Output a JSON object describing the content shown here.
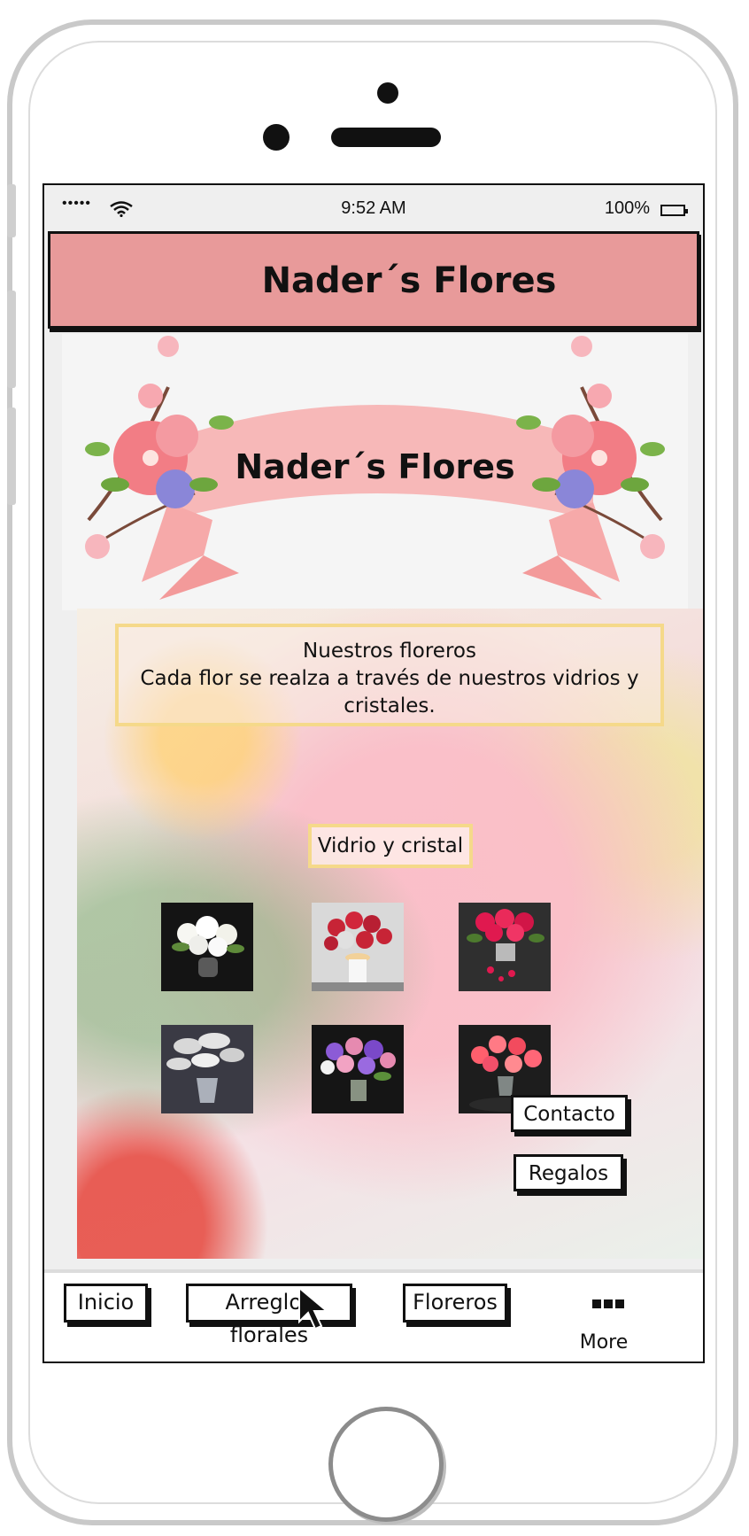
{
  "status_bar": {
    "signal": "•••••",
    "time": "9:52 AM",
    "battery": "100%"
  },
  "header": {
    "title": "Nader´s Flores"
  },
  "banner": {
    "title": "Nader´s Flores"
  },
  "intro": {
    "heading": "Nuestros floreros",
    "text": "Cada flor se realza a través de nuestros vidrios y cristales."
  },
  "section": {
    "label": "Vidrio y cristal"
  },
  "gallery": [
    {
      "name": "white-flowers-vase",
      "colors": [
        "#f7f7f2",
        "#5e8a3a"
      ]
    },
    {
      "name": "red-roses-white-vase",
      "colors": [
        "#c72436",
        "#f2f2f2"
      ]
    },
    {
      "name": "pink-roses-glass-vase",
      "colors": [
        "#e0194f",
        "#2f2f2f"
      ]
    },
    {
      "name": "silver-leaves-vase",
      "colors": [
        "#d8d8d8",
        "#3a3a44"
      ]
    },
    {
      "name": "purple-mixed-bouquet",
      "colors": [
        "#8c5bd6",
        "#e68ab0"
      ]
    },
    {
      "name": "coral-gerberas-vase",
      "colors": [
        "#ff5f6d",
        "#1d1d1d"
      ]
    }
  ],
  "side_actions": {
    "contact": "Contacto",
    "gifts": "Regalos"
  },
  "tabbar": {
    "home": "Inicio",
    "arrangements": "Arreglos florales",
    "vases": "Floreros",
    "more": "More"
  },
  "colors": {
    "header_bg": "#e89a9a",
    "accent_border": "#f5d98a"
  }
}
